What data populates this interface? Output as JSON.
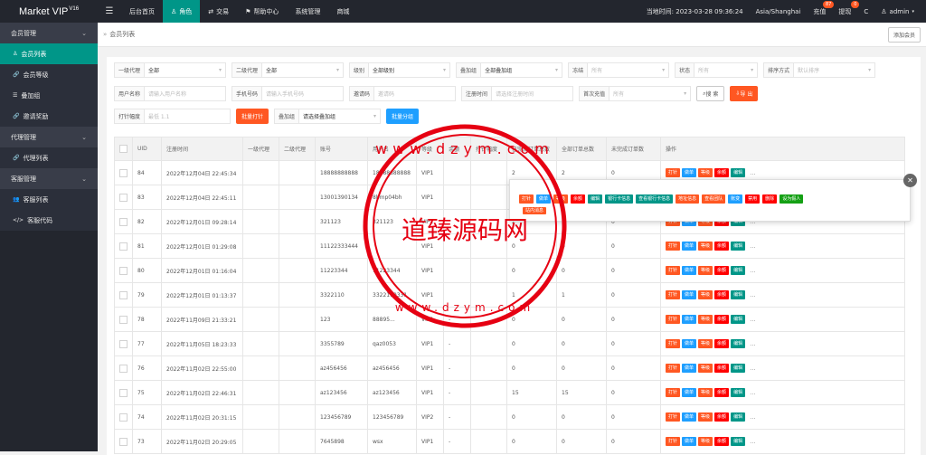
{
  "brand": {
    "name": "Market VIP",
    "version": "V16"
  },
  "topnav": [
    {
      "label": "后台首页",
      "icon": ""
    },
    {
      "label": "角色",
      "icon": "user-icon",
      "active": true
    },
    {
      "label": "交易",
      "icon": "exchange-icon"
    },
    {
      "label": "帮助中心",
      "icon": "flag-icon"
    },
    {
      "label": "系统管理",
      "icon": ""
    },
    {
      "label": "商城",
      "icon": ""
    }
  ],
  "topright": {
    "time_label": "当地时间: 2023-03-28 09:36:24",
    "timezone": "Asia/Shanghai",
    "recharge": "充值",
    "recharge_badge": "87",
    "withdraw": "提现",
    "withdraw_badge": "0",
    "refresh": "C",
    "user": "admin"
  },
  "sidebar": [
    {
      "group": "会员管理",
      "items": [
        {
          "label": "会员列表",
          "icon": "user-icon",
          "active": true
        },
        {
          "label": "会员等级",
          "icon": "link-icon"
        },
        {
          "label": "叠加组",
          "icon": "list-icon"
        },
        {
          "label": "邀请奖励",
          "icon": "link-icon"
        }
      ]
    },
    {
      "group": "代理管理",
      "items": [
        {
          "label": "代理列表",
          "icon": "link-icon"
        }
      ]
    },
    {
      "group": "客服管理",
      "items": [
        {
          "label": "客服列表",
          "icon": "users-icon"
        },
        {
          "label": "客服代码",
          "icon": "code-icon"
        }
      ]
    }
  ],
  "breadcrumb": {
    "label": "会员列表",
    "add_button": "添加会员"
  },
  "filters": {
    "row1": [
      {
        "label": "一级代理",
        "value": "全部",
        "select": true,
        "w": 90
      },
      {
        "label": "二级代理",
        "value": "全部",
        "select": true,
        "w": 90
      },
      {
        "label": "级别",
        "value": "全部级别",
        "select": true,
        "w": 90
      },
      {
        "label": "叠加组",
        "value": "全部叠加组",
        "select": true,
        "w": 90
      },
      {
        "label": "冻结",
        "value": "所有",
        "select": true,
        "ph": true,
        "w": 90
      },
      {
        "label": "状态",
        "value": "所有",
        "select": true,
        "ph": true,
        "w": 70
      },
      {
        "label": "排序方式",
        "value": "默认排序",
        "select": true,
        "ph": true,
        "w": 90
      }
    ],
    "row2": [
      {
        "label": "用户名称",
        "value": "请输入用户名称",
        "ph": true,
        "w": 90
      },
      {
        "label": "手机号码",
        "value": "请输入手机号码",
        "ph": true,
        "w": 90
      },
      {
        "label": "邀请码",
        "value": "邀请码",
        "ph": true,
        "w": 90
      },
      {
        "label": "注册时间",
        "value": "请选择注册时间",
        "ph": true,
        "w": 90
      },
      {
        "label": "首次充值",
        "value": "所有",
        "select": true,
        "ph": true,
        "w": 90
      }
    ],
    "search_button": "搜 索",
    "export_button": "导 出",
    "row3": {
      "ratio_label": "打针幅度",
      "ratio_placeholder": "最低 1.1",
      "batch_ratio_button": "批量打针",
      "group_label": "叠加组",
      "group_value": "请选择叠加组",
      "batch_group_button": "批量分组"
    }
  },
  "table": {
    "headers": [
      "",
      "UID",
      "注册时间",
      "一级代理",
      "二级代理",
      "账号",
      "用户名",
      "等级",
      "余额",
      "打针幅度",
      "已完成订单总数",
      "全部订单总数",
      "未完成订单数",
      "操作"
    ],
    "rows": [
      [
        "84",
        "2022年12月04日 22:45:34",
        "",
        "",
        "18888888888",
        "18888888888",
        "VIP1",
        "",
        "",
        "2",
        "2",
        "0"
      ],
      [
        "83",
        "2022年12月04日 22:45:11",
        "",
        "",
        "13001390134",
        "8bmp04bh",
        "VIP1",
        "",
        "",
        "",
        "",
        ""
      ],
      [
        "82",
        "2022年12月01日 09:28:14",
        "",
        "",
        "321123",
        "321123",
        "VIP1",
        "",
        "",
        "2",
        "2",
        "0"
      ],
      [
        "81",
        "2022年12月01日 01:29:08",
        "",
        "",
        "11122333444",
        "",
        "VIP1",
        "",
        "",
        "0",
        "0",
        "0"
      ],
      [
        "80",
        "2022年12月01日 01:16:04",
        "",
        "",
        "11223344",
        "11223344",
        "VIP1",
        "",
        "",
        "0",
        "0",
        "0"
      ],
      [
        "79",
        "2022年12月01日 01:13:37",
        "",
        "",
        "3322110",
        "3322110331",
        "VIP1",
        "",
        "",
        "1",
        "1",
        "0"
      ],
      [
        "78",
        "2022年11月09日 21:33:21",
        "",
        "",
        "123",
        "88895...",
        "VIP1",
        "-",
        "",
        "0",
        "0",
        "0"
      ],
      [
        "77",
        "2022年11月05日 18:23:33",
        "",
        "",
        "3355789",
        "qaz0053",
        "VIP1",
        "-",
        "",
        "0",
        "0",
        "0"
      ],
      [
        "76",
        "2022年11月02日 22:55:00",
        "",
        "",
        "az456456",
        "az456456",
        "VIP1",
        "-",
        "",
        "0",
        "0",
        "0"
      ],
      [
        "75",
        "2022年11月02日 22:46:31",
        "",
        "",
        "az123456",
        "az123456",
        "VIP1",
        "-",
        "",
        "15",
        "15",
        "0"
      ],
      [
        "74",
        "2022年11月02日 20:31:15",
        "",
        "",
        "123456789",
        "123456789",
        "VIP2",
        "-",
        "",
        "0",
        "0",
        "0"
      ],
      [
        "73",
        "2022年11月02日 20:29:05",
        "",
        "",
        "7645898",
        "wsx",
        "VIP1",
        "-",
        "",
        "0",
        "0",
        "0"
      ]
    ],
    "row_ops": [
      {
        "label": "打针",
        "color": "orange"
      },
      {
        "label": "做单",
        "color": "blue"
      },
      {
        "label": "等级",
        "color": "orange"
      },
      {
        "label": "余额",
        "color": "red"
      },
      {
        "label": "编辑",
        "color": "green"
      },
      {
        "label": "...",
        "color": "more"
      }
    ]
  },
  "popup": {
    "ops": [
      {
        "label": "打针",
        "color": "orange"
      },
      {
        "label": "做单",
        "color": "blue"
      },
      {
        "label": "等级",
        "color": "orange"
      },
      {
        "label": "余额",
        "color": "red"
      },
      {
        "label": "编辑",
        "color": "green"
      },
      {
        "label": "银行卡信息",
        "color": "green"
      },
      {
        "label": "查看银行卡信息",
        "color": "green"
      },
      {
        "label": "地址信息",
        "color": "orange"
      },
      {
        "label": "查看团队",
        "color": "orange"
      },
      {
        "label": "账变",
        "color": "blue"
      },
      {
        "label": "禁用",
        "color": "red"
      },
      {
        "label": "删除",
        "color": "red"
      },
      {
        "label": "设为假人",
        "color": "dark-green"
      }
    ],
    "extra": "站内消息"
  },
  "watermark": {
    "text": "道臻源码网",
    "url_top": "www.dzym.com",
    "url_bottom": "www.dzym.com"
  }
}
